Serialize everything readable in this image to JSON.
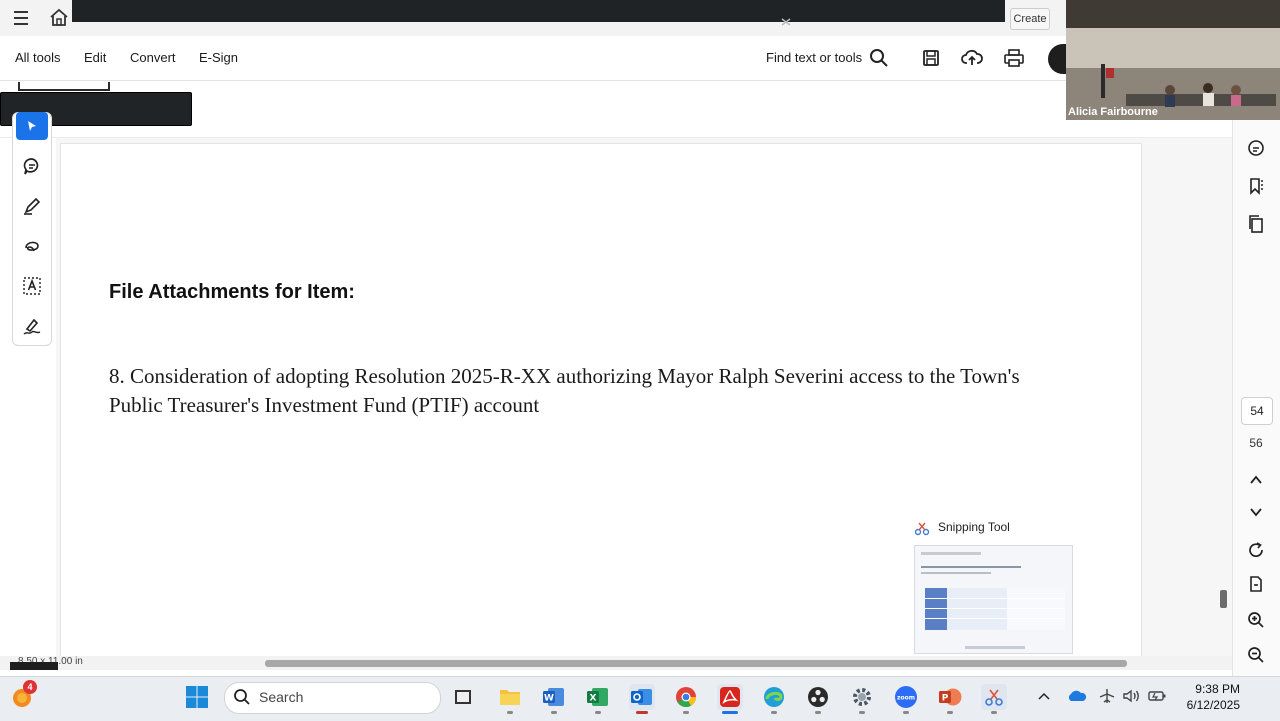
{
  "browser": {
    "create_label": "Create"
  },
  "toolbar": {
    "menu": [
      "All tools",
      "Edit",
      "Convert",
      "E-Sign"
    ],
    "find_label": "Find text or tools"
  },
  "document": {
    "heading": "File Attachments for Item:",
    "item_text": "8. Consideration of adopting Resolution 2025-R-XX authorizing Mayor Ralph Severini access to the Town's Public Treasurer's Investment Fund (PTIF) account"
  },
  "navigation": {
    "current_page": "54",
    "total_pages": "56"
  },
  "status": {
    "page_size": "8.50 x 11.00 in"
  },
  "video": {
    "participant_name": "Alicia Fairbourne"
  },
  "snipping": {
    "title": "Snipping Tool"
  },
  "taskbar": {
    "search_placeholder": "Search",
    "time": "9:38 PM",
    "date": "6/12/2025",
    "notification_count": "4"
  },
  "colors": {
    "accent": "#1a73e8",
    "adobe_red": "#d7261e"
  }
}
